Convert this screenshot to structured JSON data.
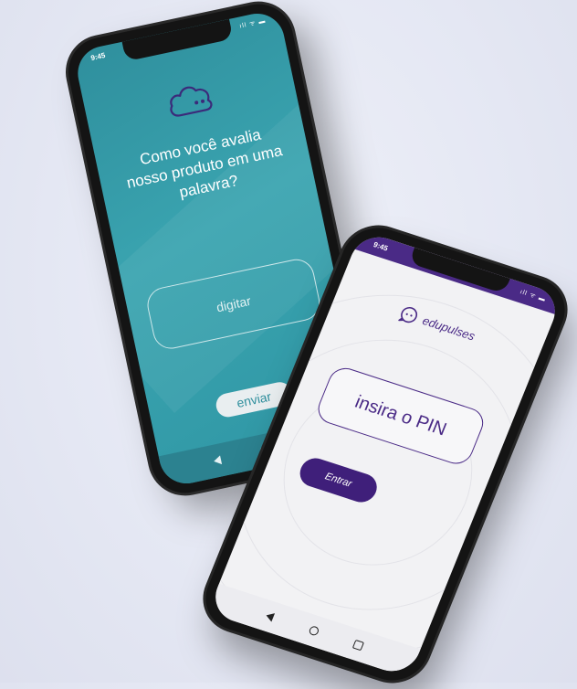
{
  "survey_phone": {
    "status_time": "9:45",
    "status_icons": "ıll ᯤ ▬",
    "question": "Como você avalia nosso produto em uma palavra?",
    "answer_placeholder": "digitar",
    "send_label": "enviar",
    "colors": {
      "screen_bg": "#3aa4b0",
      "cloud_stroke": "#3b2a7a",
      "button_bg": "#e9eef0"
    },
    "icons": [
      "cloud-icon",
      "nav-back-icon",
      "nav-home-icon",
      "nav-recent-icon"
    ]
  },
  "pin_phone": {
    "status_time": "9:45",
    "status_icons": "ıll ᯤ ▬",
    "brand_name": "edupulses",
    "pin_placeholder": "insira o PIN",
    "enter_label": "Entrar",
    "colors": {
      "brand": "#4a2a86",
      "button_bg": "#3f1f7a",
      "screen_bg": "#f2f2f4"
    },
    "icons": [
      "edupulses-logo-icon",
      "nav-back-icon",
      "nav-home-icon",
      "nav-recent-icon"
    ]
  }
}
